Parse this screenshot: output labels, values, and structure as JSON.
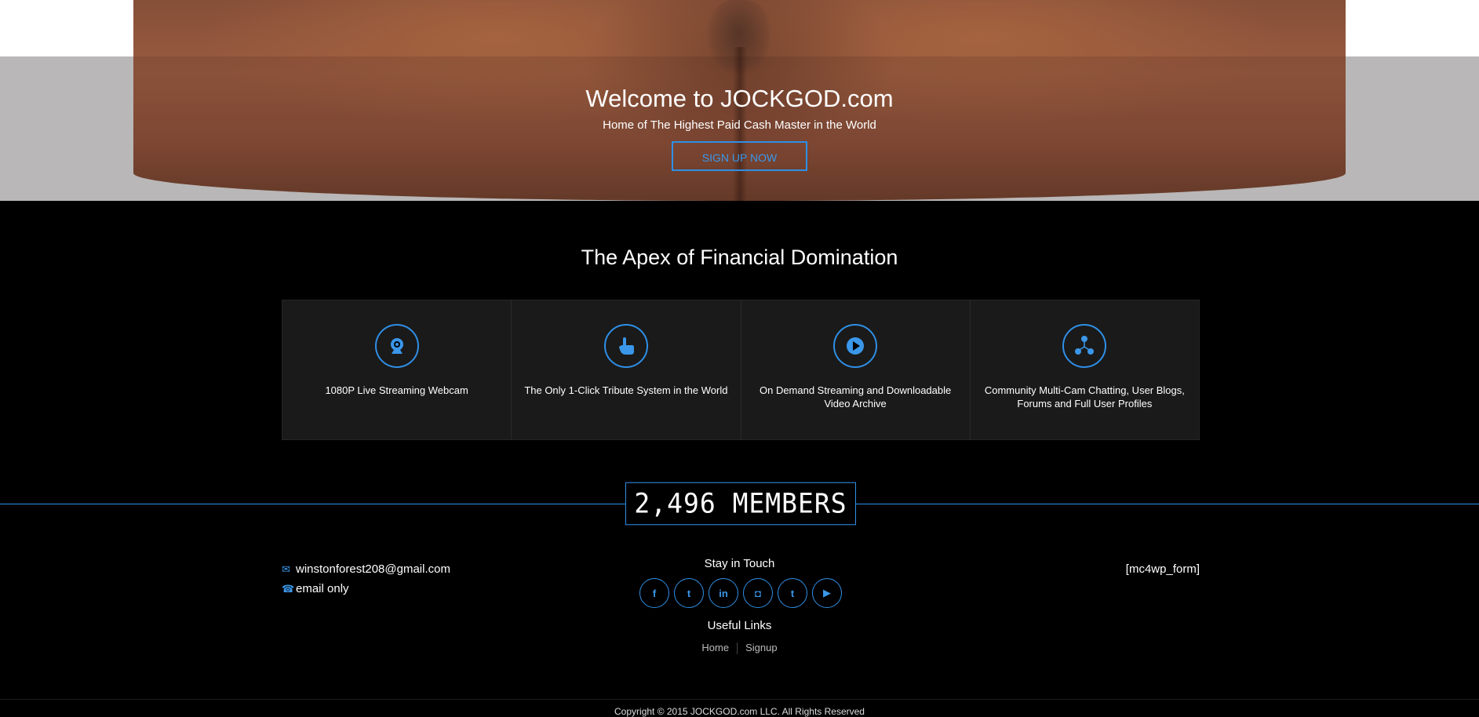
{
  "hero": {
    "title": "Welcome to JOCKGOD.com",
    "subtitle": "Home of The Highest Paid Cash Master in the World",
    "signup_label": "SIGN UP NOW"
  },
  "section_title": "The Apex of Financial Domination",
  "features": [
    {
      "icon": "webcam-icon",
      "text": "1080P Live Streaming Webcam"
    },
    {
      "icon": "pointer-hand-icon",
      "text": "The Only 1-Click Tribute System in the World"
    },
    {
      "icon": "play-icon",
      "text": "On Demand Streaming and Downloadable Video Archive"
    },
    {
      "icon": "community-network-icon",
      "text": "Community Multi-Cam Chatting, User Blogs, Forums and Full User Profiles"
    }
  ],
  "members_counter": "2,496 MEMBERS",
  "contact": {
    "email": "winstonforest208@gmail.com",
    "phone_note": "email only"
  },
  "stay_in_touch": "Stay in Touch",
  "socials": [
    {
      "icon": "facebook-icon",
      "glyph": "f"
    },
    {
      "icon": "twitter-icon",
      "glyph": "t"
    },
    {
      "icon": "linkedin-icon",
      "glyph": "in"
    },
    {
      "icon": "instagram-icon",
      "glyph": "◘"
    },
    {
      "icon": "tumblr-icon",
      "glyph": "t"
    },
    {
      "icon": "youtube-icon",
      "glyph": "▶"
    }
  ],
  "useful_links_title": "Useful Links",
  "useful_links": [
    "Home",
    "Signup"
  ],
  "newsletter_placeholder": "[mc4wp_form]",
  "copyright": "Copyright © 2015 JOCKGOD.com LLC. All Rights Reserved",
  "colors": {
    "accent": "#2f8fe6",
    "background": "#000000",
    "panel": "#1a1a1a"
  }
}
